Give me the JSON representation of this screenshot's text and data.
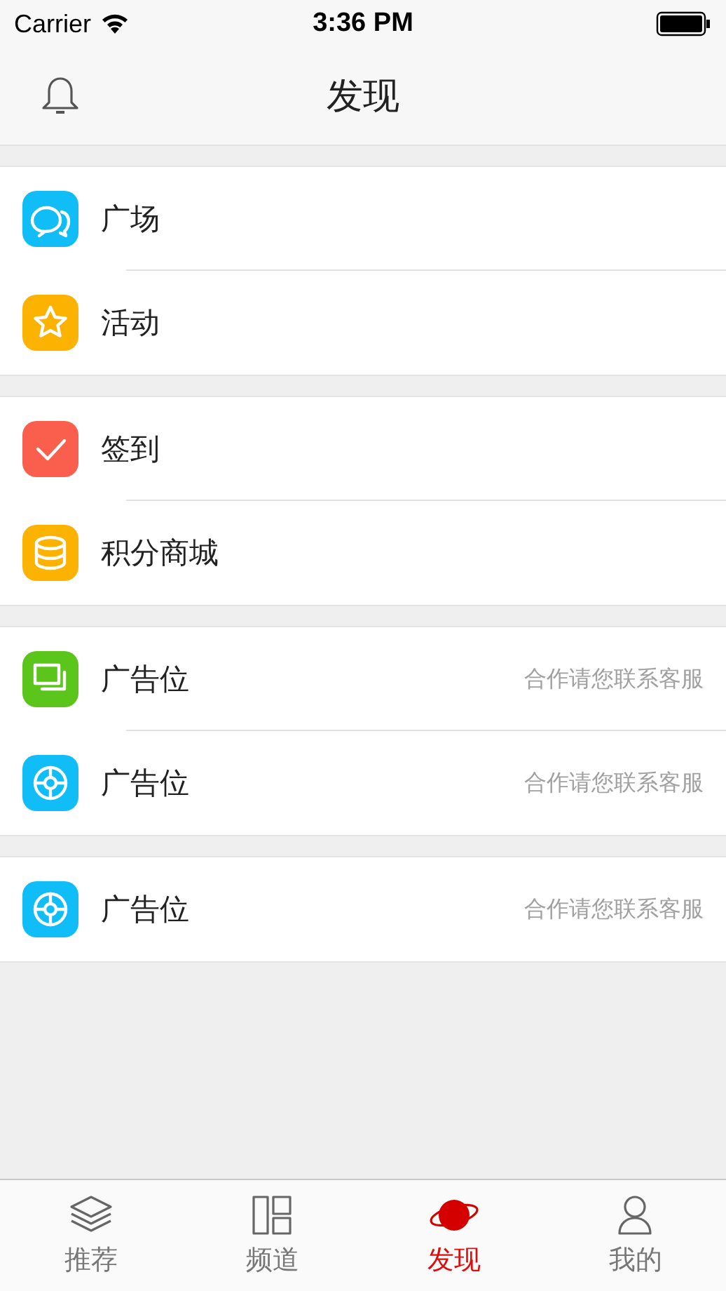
{
  "status_bar": {
    "carrier": "Carrier",
    "time": "3:36 PM"
  },
  "header": {
    "title": "发现"
  },
  "sections": [
    {
      "items": [
        {
          "kind": "chat",
          "color": "#10bdf6",
          "label": "广场"
        },
        {
          "kind": "star",
          "color": "#fbb200",
          "label": "活动"
        }
      ]
    },
    {
      "items": [
        {
          "kind": "check",
          "color": "#fa5f4e",
          "label": "签到"
        },
        {
          "kind": "coins",
          "color": "#fbb200",
          "label": "积分商城"
        }
      ]
    },
    {
      "items": [
        {
          "kind": "screens",
          "color": "#5bc51b",
          "label": "广告位",
          "note": "合作请您联系客服"
        },
        {
          "kind": "target",
          "color": "#10bdf6",
          "label": "广告位",
          "note": "合作请您联系客服"
        }
      ]
    },
    {
      "items": [
        {
          "kind": "target",
          "color": "#10bdf6",
          "label": "广告位",
          "note": "合作请您联系客服"
        }
      ]
    }
  ],
  "tab_bar": [
    {
      "kind": "layers",
      "label": "推荐",
      "selected": false
    },
    {
      "kind": "grid",
      "label": "频道",
      "selected": false
    },
    {
      "kind": "planet",
      "label": "发现",
      "selected": true
    },
    {
      "kind": "person",
      "label": "我的",
      "selected": false
    }
  ]
}
